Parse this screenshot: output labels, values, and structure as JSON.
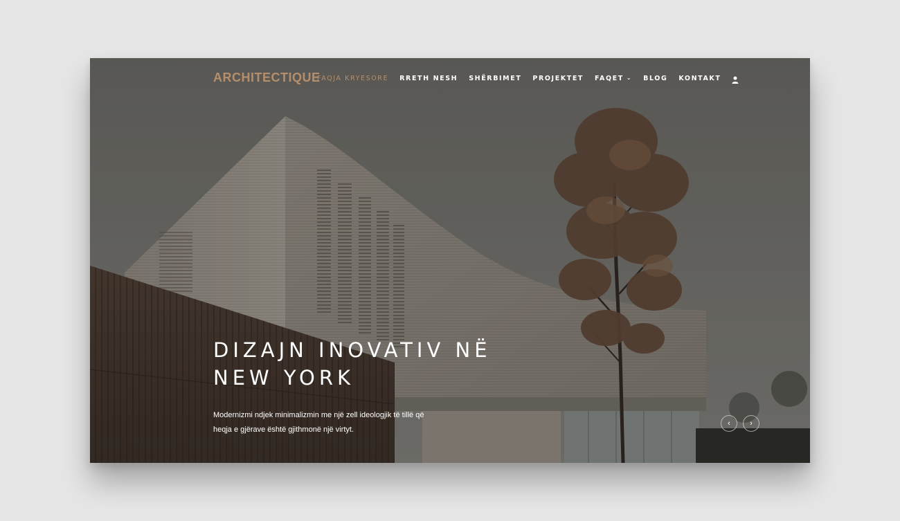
{
  "site": {
    "logo": "ARCHITECTIQUE"
  },
  "nav": {
    "items": [
      {
        "label": "FAQJA KRYESORE",
        "active": true
      },
      {
        "label": "RRETH NESH"
      },
      {
        "label": "SHËRBIMET"
      },
      {
        "label": "PROJEKTET"
      },
      {
        "label": "FAQET",
        "dropdown": true
      },
      {
        "label": "BLOG"
      },
      {
        "label": "KONTAKT"
      }
    ],
    "user_icon": "user-icon"
  },
  "hero": {
    "title_line1": "DIZAJN INOVATIV NË",
    "title_line2": "NEW YORK",
    "text": "Modernizmi ndjek minimalizmin me një zell ideologjik të tillë që heqja e gjërave është gjithmonë një virtyt."
  },
  "slider": {
    "prev_icon": "chevron-left-icon",
    "next_icon": "chevron-right-icon"
  },
  "colors": {
    "accent": "#b58f6c",
    "sky": "#6c6b66",
    "background": "#e6e6e6"
  }
}
